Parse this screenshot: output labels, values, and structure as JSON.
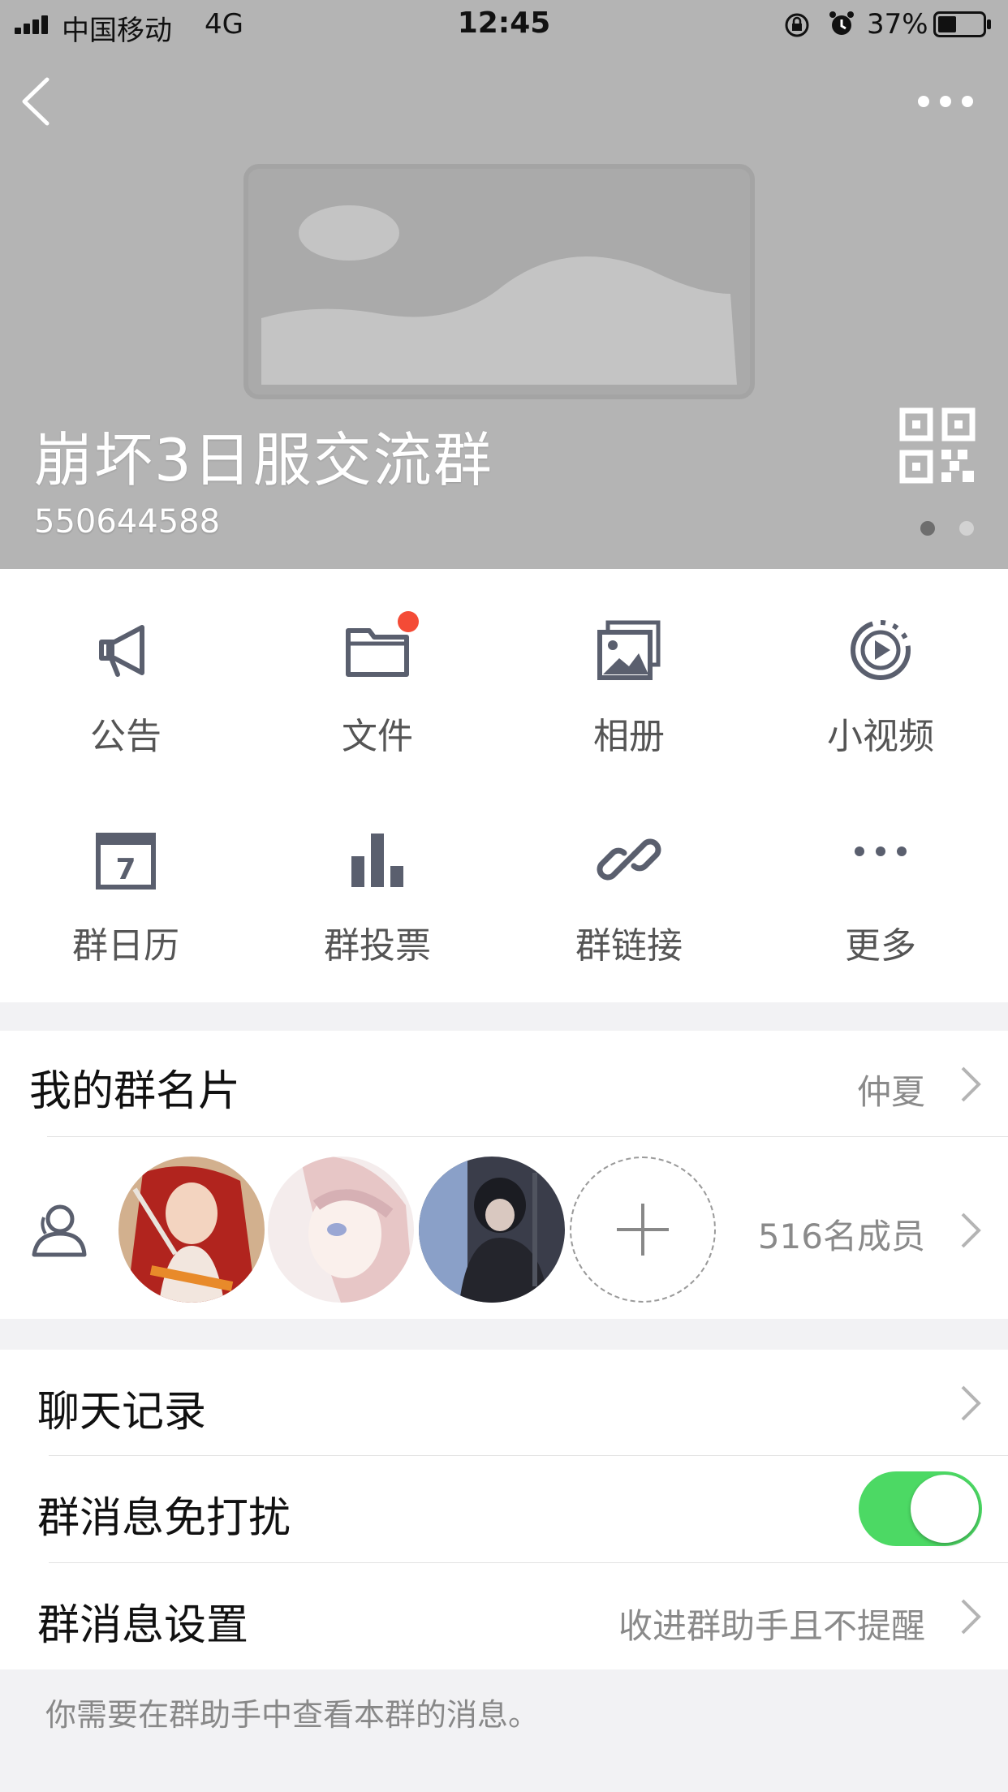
{
  "status_bar": {
    "carrier": "中国移动",
    "network": "4G",
    "time": "12:45",
    "battery": "37%"
  },
  "header": {
    "group_name": "崩坏3日服交流群",
    "group_id": "550644588"
  },
  "features": [
    {
      "label": "公告",
      "icon": "megaphone-icon"
    },
    {
      "label": "文件",
      "icon": "folder-icon"
    },
    {
      "label": "相册",
      "icon": "photo-album-icon"
    },
    {
      "label": "小视频",
      "icon": "video-icon"
    },
    {
      "label": "群日历",
      "icon": "calendar-icon",
      "icon_text": "7"
    },
    {
      "label": "群投票",
      "icon": "bar-chart-icon"
    },
    {
      "label": "群链接",
      "icon": "link-icon"
    },
    {
      "label": "更多",
      "icon": "more-dots-icon"
    }
  ],
  "card": {
    "label": "我的群名片",
    "value": "仲夏"
  },
  "members": {
    "count_text": "516名成员"
  },
  "chat_history": {
    "label": "聊天记录"
  },
  "mute": {
    "label": "群消息免打扰",
    "enabled": true
  },
  "msg_settings": {
    "label": "群消息设置",
    "value": "收进群助手且不提醒"
  },
  "hint": "你需要在群助手中查看本群的消息。",
  "colors": {
    "header_bg": "#b4b4b4",
    "icon": "#5a5f6e",
    "badge": "#f44b36",
    "toggle_on": "#4cd964"
  }
}
